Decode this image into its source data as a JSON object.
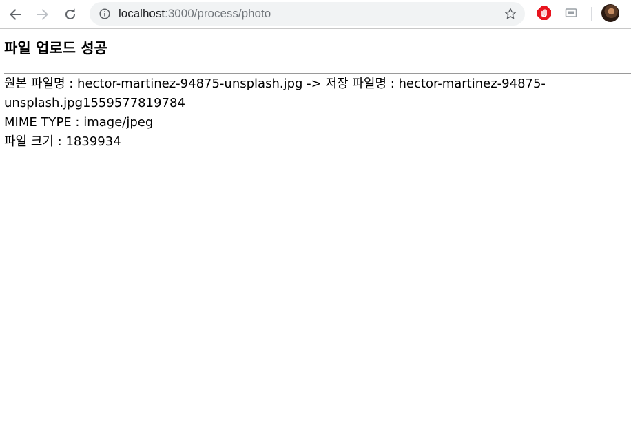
{
  "browser": {
    "url_host": "localhost",
    "url_path": ":3000/process/photo"
  },
  "page": {
    "title": "파일 업로드 성공",
    "original_label": "원본 파일명 : ",
    "original_name": "hector-martinez-94875-unsplash.jpg",
    "arrow": " -> ",
    "saved_label": "저장 파일명 : ",
    "saved_name": "hector-martinez-94875-unsplash.jpg1559577819784",
    "mime_label": "MIME TYPE : ",
    "mime_value": "image/jpeg",
    "size_label": "파일 크기 : ",
    "size_value": "1839934"
  },
  "icons": {
    "back": "back-arrow-icon",
    "forward": "forward-arrow-icon",
    "reload": "reload-icon",
    "info": "info-icon",
    "bookmark": "star-icon",
    "extension_1": "stop-sign-icon",
    "extension_2": "cast-icon",
    "profile": "avatar"
  },
  "colors": {
    "omnibox_bg": "#f1f3f4",
    "url_path": "#70757a",
    "stop_sign": "#e8141e"
  }
}
